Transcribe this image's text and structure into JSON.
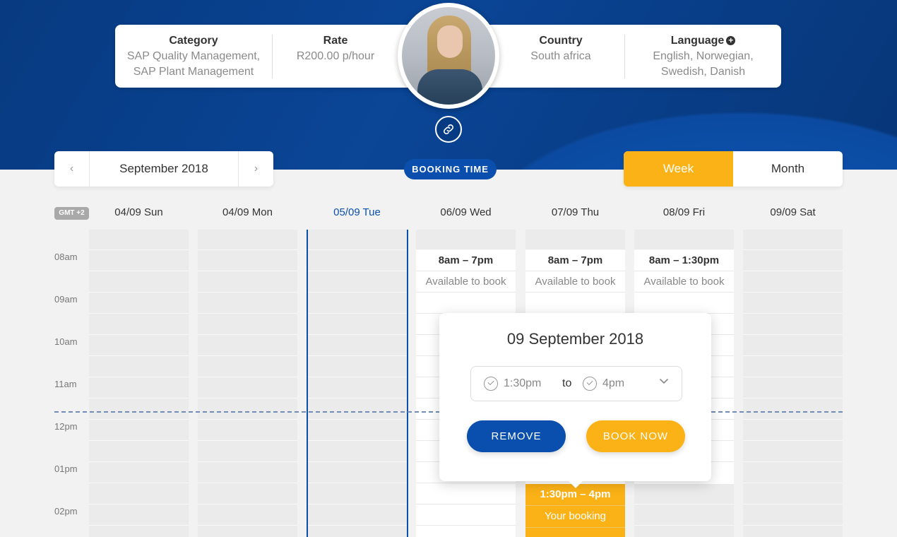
{
  "profile": {
    "category": {
      "label": "Category",
      "lines": [
        "SAP Quality Management,",
        "SAP Plant Management"
      ]
    },
    "rate": {
      "label": "Rate",
      "value": "R200.00 p/hour"
    },
    "country": {
      "label": "Country",
      "value": "South africa"
    },
    "language": {
      "label": "Language",
      "lines": [
        "English, Norwegian,",
        "Swedish, Danish"
      ]
    }
  },
  "calendar_nav": {
    "month": "September 2018"
  },
  "booking_badge": "BOOKING TIME",
  "view": {
    "week": "Week",
    "month": "Month",
    "active": "Week"
  },
  "timezone": "GMT +2",
  "days": [
    "04/09 Sun",
    "04/09 Mon",
    "05/09 Tue",
    "06/09 Wed",
    "07/09 Thu",
    "08/09 Fri",
    "09/09 Sat"
  ],
  "hours": [
    "08am",
    "09am",
    "10am",
    "11am",
    "12pm",
    "01pm",
    "02pm"
  ],
  "availability": [
    {
      "time": "8am – 7pm",
      "status": "Available to book"
    },
    {
      "time": "8am – 7pm",
      "status": "Available to book"
    },
    {
      "time": "8am – 1:30pm",
      "status": "Available to book"
    }
  ],
  "your_booking": {
    "time": "1:30pm – 4pm",
    "status": "Your booking"
  },
  "popup": {
    "date": "09 September 2018",
    "from": "1:30pm",
    "to_label": "to",
    "to": "4pm",
    "remove": "REMOVE",
    "book": "BOOK NOW"
  },
  "colors": {
    "primary": "#0a4fae",
    "accent": "#fbb216"
  }
}
